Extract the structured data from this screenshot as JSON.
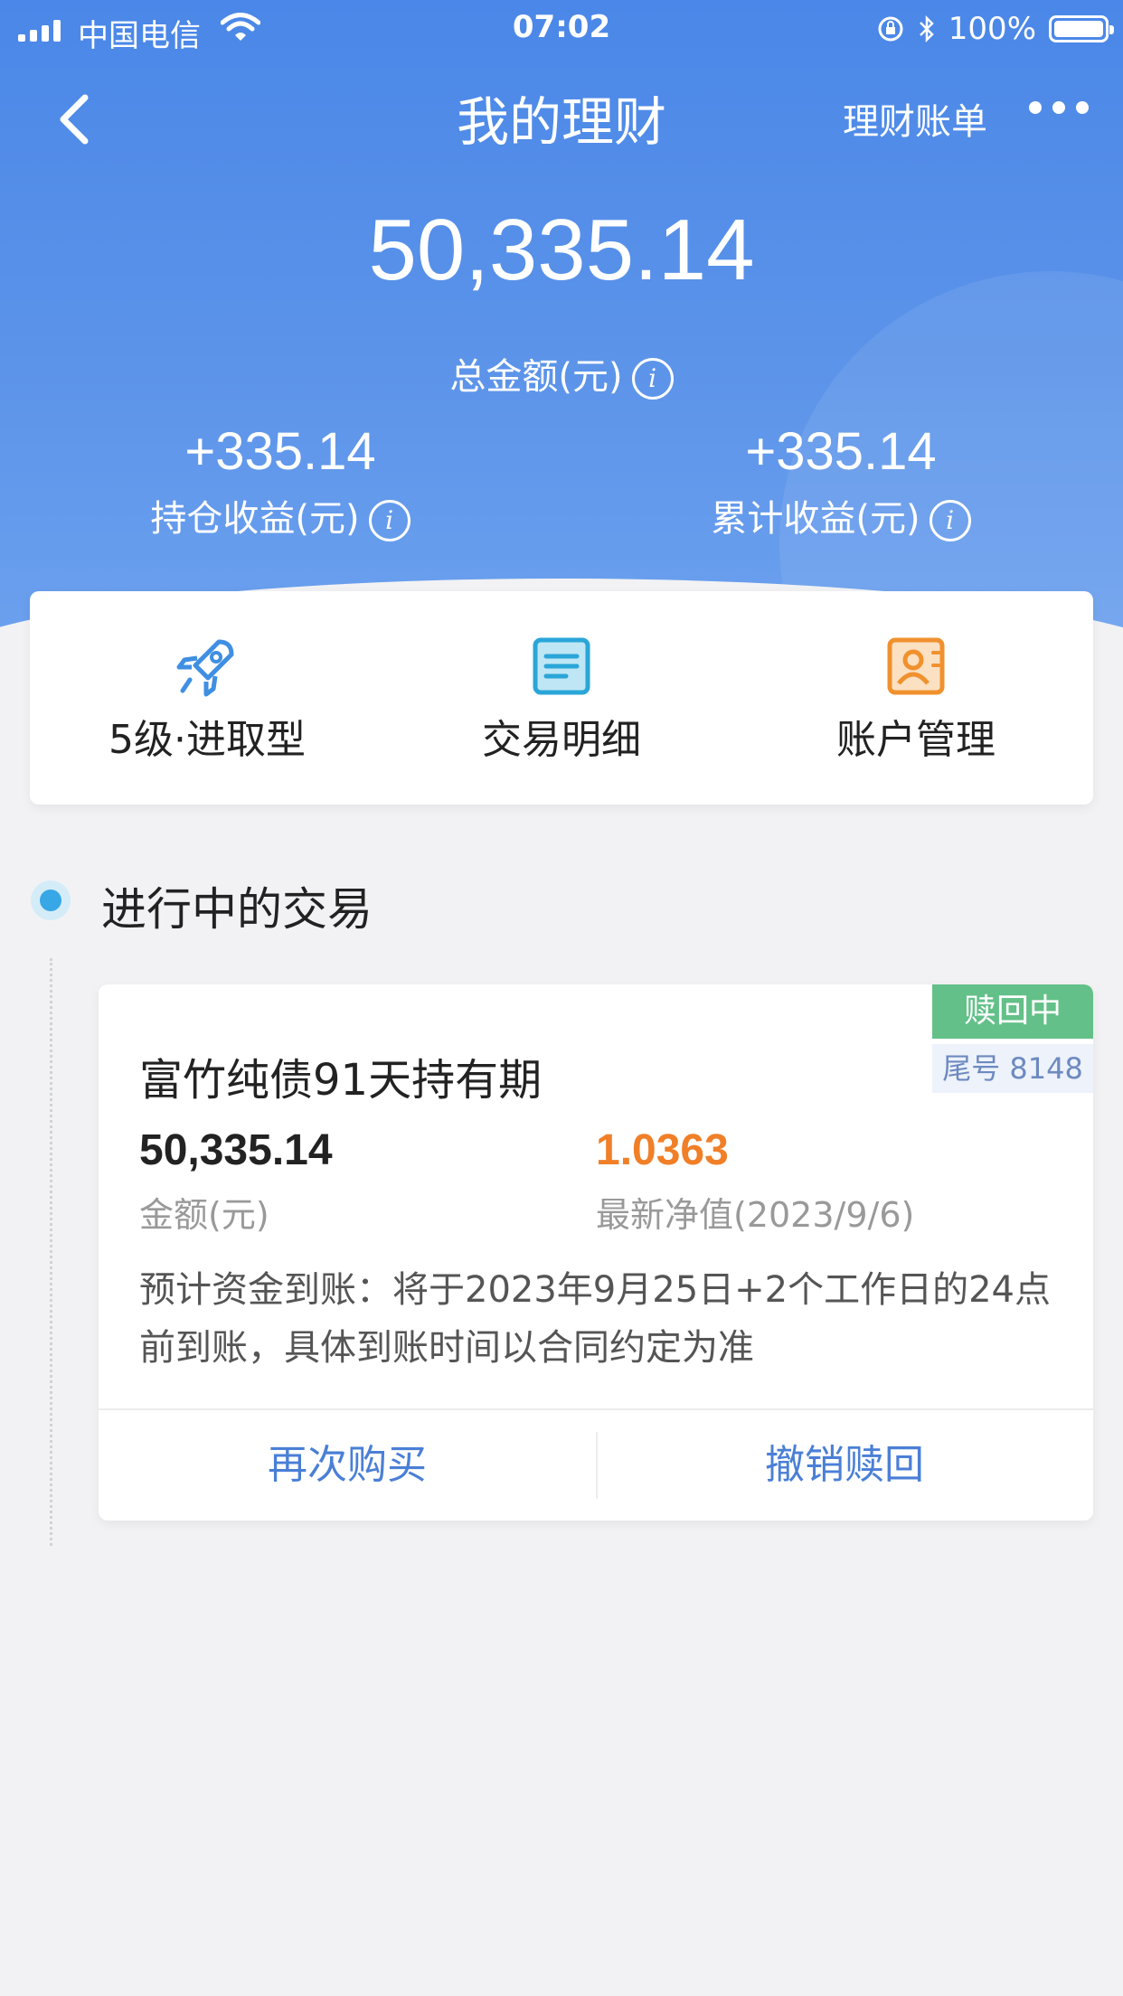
{
  "status_bar": {
    "carrier": "中国电信",
    "time": "07:02",
    "battery": "100%"
  },
  "nav": {
    "title": "我的理财",
    "bill_label": "理财账单"
  },
  "summary": {
    "total": "50,335.14",
    "total_label": "总金额(元)",
    "holding_profit": "+335.14",
    "holding_profit_label": "持仓收益(元)",
    "cumulative_profit": "+335.14",
    "cumulative_profit_label": "累计收益(元)"
  },
  "quick_actions": [
    {
      "label": "5级·进取型",
      "icon": "rocket-icon"
    },
    {
      "label": "交易明细",
      "icon": "document-icon"
    },
    {
      "label": "账户管理",
      "icon": "contact-card-icon"
    }
  ],
  "section": {
    "title": "进行中的交易"
  },
  "transaction": {
    "status": "赎回中",
    "tail_number": "尾号 8148",
    "product": "富竹纯债91天持有期",
    "amount": "50,335.14",
    "amount_label": "金额(元)",
    "nav_value": "1.0363",
    "nav_label": "最新净值(2023/9/6)",
    "note": "预计资金到账：将于2023年9月25日+2个工作日的24点前到账，具体到账时间以合同约定为准",
    "buy_again": "再次购买",
    "cancel_redeem": "撤销赎回"
  },
  "colors": {
    "hero": "#4a87e8",
    "accent_blue": "#4a7fd6",
    "status_green": "#63c088",
    "nav_orange": "#f07f28"
  }
}
